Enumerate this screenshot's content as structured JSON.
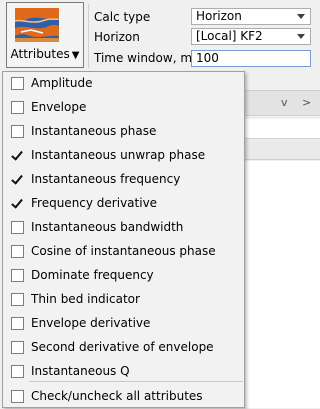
{
  "toolbar": {
    "attributes_button": {
      "label": "Attributes",
      "caret": "▼",
      "thumbnail": "seismic-attribute-thumbnail"
    },
    "calc_type": {
      "label": "Calc type",
      "value": "Horizon"
    },
    "horizon": {
      "label": "Horizon",
      "value": "[Local] KF2"
    },
    "time_window": {
      "label": "Time window, ms",
      "value": "100"
    }
  },
  "background_panel": {
    "chevron_down": "v",
    "chevron_right": ">"
  },
  "attributes_menu": {
    "items": [
      {
        "label": "Amplitude",
        "checked": false
      },
      {
        "label": "Envelope",
        "checked": false
      },
      {
        "label": "Instantaneous phase",
        "checked": false
      },
      {
        "label": "Instantaneous unwrap phase",
        "checked": true
      },
      {
        "label": "Instantaneous frequency",
        "checked": true
      },
      {
        "label": "Frequency derivative",
        "checked": true
      },
      {
        "label": "Instantaneous bandwidth",
        "checked": false
      },
      {
        "label": "Cosine of instantaneous phase",
        "checked": false
      },
      {
        "label": "Dominate frequency",
        "checked": false
      },
      {
        "label": "Thin bed indicator",
        "checked": false
      },
      {
        "label": "Envelope derivative",
        "checked": false
      },
      {
        "label": "Second derivative of envelope",
        "checked": false
      },
      {
        "label": "Instantaneous Q",
        "checked": false
      }
    ],
    "check_all": {
      "label": "Check/uncheck all attributes",
      "checked": false
    }
  },
  "colors": {
    "menu_bg": "#f2f2f2",
    "thumb_orange": "#e06a1c",
    "thumb_blue": "#2e5fa8"
  }
}
